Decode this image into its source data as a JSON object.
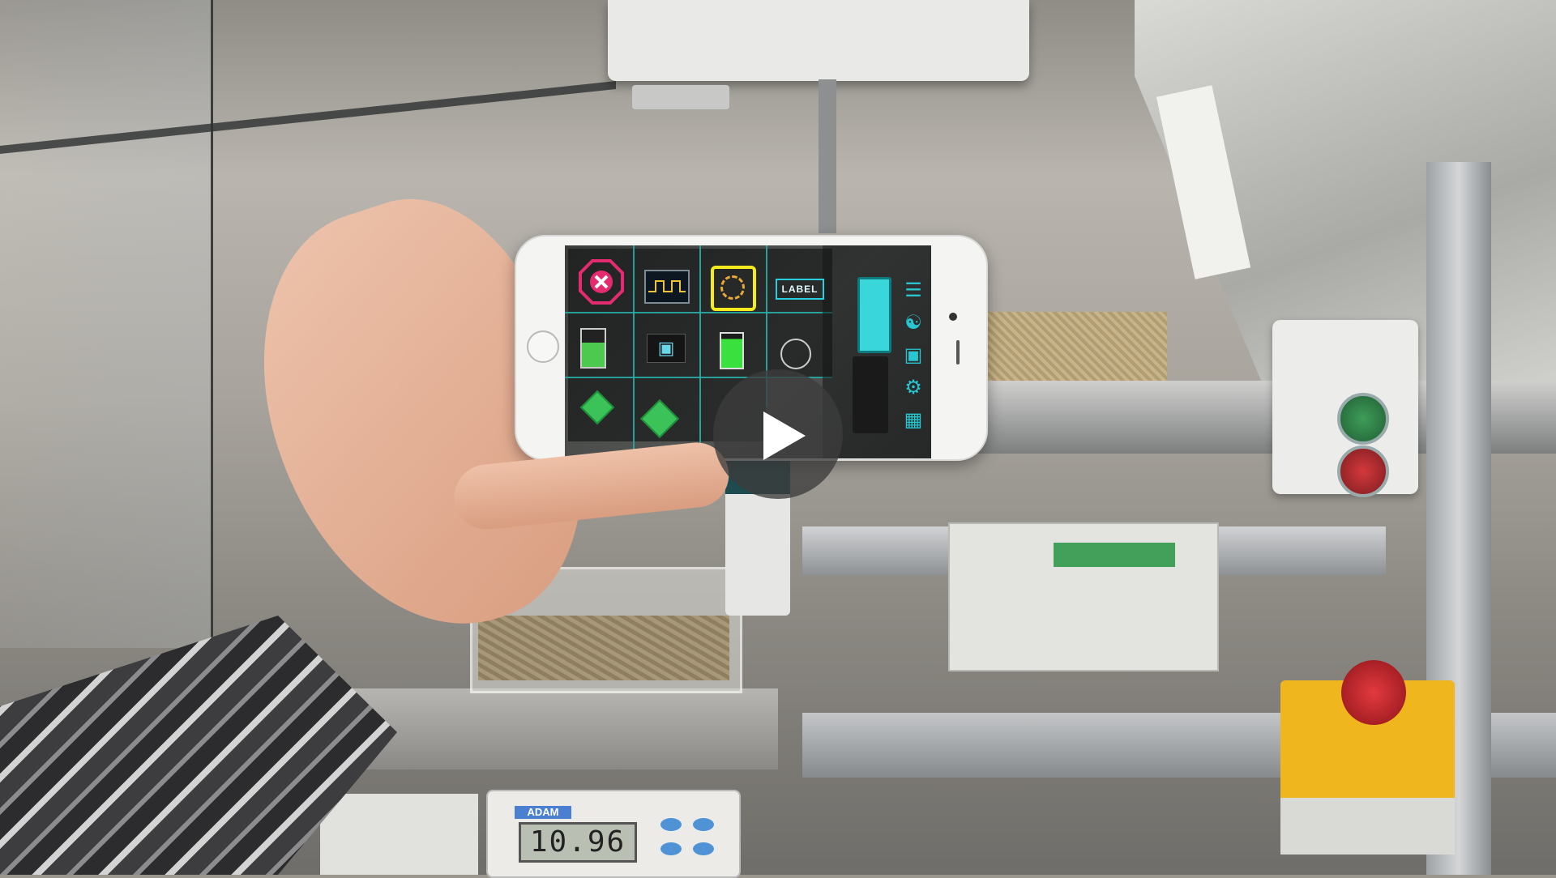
{
  "scene": {
    "phone_app": {
      "widgets": {
        "label_widget": "LABEL"
      },
      "side_toolbar_icons": [
        "list-icon",
        "nodes-icon",
        "box-icon",
        "gear-icon",
        "cube-frame-icon"
      ]
    },
    "scale": {
      "brand": "ADAM",
      "display_value": "10.96"
    },
    "overlay": {
      "play_icon": "play-icon"
    },
    "colors": {
      "stop_red": "#e52b6f",
      "accent_cyan": "#27c6d1",
      "spinner_yellow": "#f4ea1e",
      "button_green": "#3bc35a"
    }
  }
}
